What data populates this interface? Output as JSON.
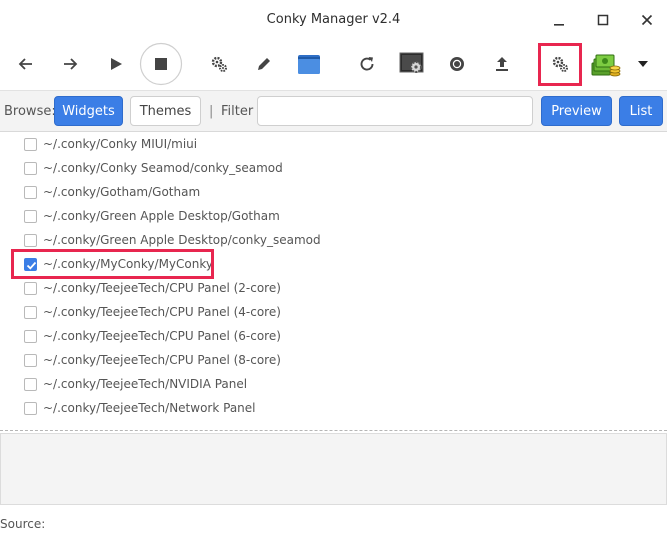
{
  "window": {
    "title": "Conky Manager v2.4"
  },
  "window_controls": [
    "minimize",
    "maximize",
    "close"
  ],
  "toolbar": {
    "buttons": [
      {
        "icon": "back-arrow-icon"
      },
      {
        "icon": "forward-arrow-icon"
      },
      {
        "icon": "play-icon"
      },
      {
        "icon": "stop-icon"
      },
      {
        "icon": "gears-icon"
      },
      {
        "icon": "pencil-icon"
      },
      {
        "icon": "folder-icon"
      },
      {
        "icon": "refresh-icon"
      },
      {
        "icon": "desktop-settings-icon"
      },
      {
        "icon": "record-icon"
      },
      {
        "icon": "upload-icon"
      },
      {
        "icon": "settings-gears-icon",
        "highlighted": true
      },
      {
        "icon": "donate-money-icon"
      },
      {
        "icon": "dropdown-arrow-icon"
      }
    ]
  },
  "browse": {
    "label": "Browse:",
    "widgets_label": "Widgets",
    "themes_label": "Themes",
    "separator": "|",
    "filter_label": "Filter",
    "filter_value": "",
    "preview_label": "Preview",
    "list_label": "List"
  },
  "items": [
    {
      "path": "~/.conky/Conky MIUI/miui",
      "checked": false
    },
    {
      "path": "~/.conky/Conky Seamod/conky_seamod",
      "checked": false
    },
    {
      "path": "~/.conky/Gotham/Gotham",
      "checked": false
    },
    {
      "path": "~/.conky/Green Apple Desktop/Gotham",
      "checked": false
    },
    {
      "path": "~/.conky/Green Apple Desktop/conky_seamod",
      "checked": false
    },
    {
      "path": "~/.conky/MyConky/MyConky",
      "checked": true,
      "highlighted": true
    },
    {
      "path": "~/.conky/TeejeeTech/CPU Panel (2-core)",
      "checked": false
    },
    {
      "path": "~/.conky/TeejeeTech/CPU Panel (4-core)",
      "checked": false
    },
    {
      "path": "~/.conky/TeejeeTech/CPU Panel (6-core)",
      "checked": false
    },
    {
      "path": "~/.conky/TeejeeTech/CPU Panel (8-core)",
      "checked": false
    },
    {
      "path": "~/.conky/TeejeeTech/NVIDIA Panel",
      "checked": false
    },
    {
      "path": "~/.conky/TeejeeTech/Network Panel",
      "checked": false
    }
  ],
  "status": {
    "source_label": "Source:"
  },
  "colors": {
    "accent": "#3b7ee6",
    "highlight": "#e8264f"
  }
}
